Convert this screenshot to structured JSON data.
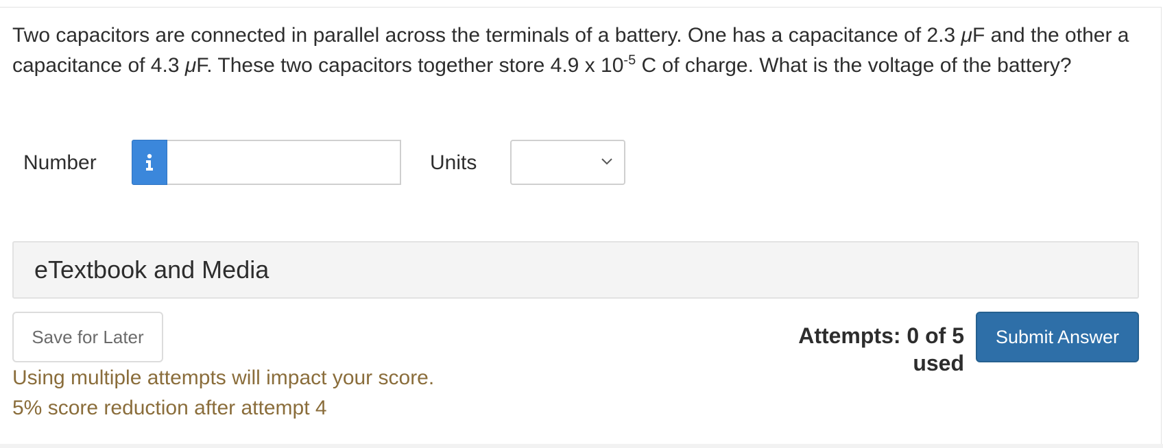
{
  "question": {
    "part1": "Two capacitors are connected in parallel across the terminals of a battery. One has a capacitance of 2.3 ",
    "mu1": "μ",
    "part2": "F and the other a capacitance of 4.3 ",
    "mu2": "μ",
    "part3": "F. These two capacitors together store 4.9 x 10",
    "exponent": "-5",
    "part4": " C of charge. What is the voltage of the battery?"
  },
  "answer_row": {
    "number_label": "Number",
    "info_icon": "info-icon",
    "number_value": "",
    "units_label": "Units",
    "units_selected": ""
  },
  "media": {
    "label": "eTextbook and Media"
  },
  "footer": {
    "save_label": "Save for Later",
    "attempts_text": "Attempts: 0 of 5 used",
    "submit_label": "Submit Answer",
    "warning_line1": "Using multiple attempts will impact your score.",
    "warning_line2": "5% score reduction after attempt 4"
  },
  "colors": {
    "info_button": "#3b87db",
    "submit_button": "#2e6fa8",
    "warning_text": "#8a6d3b",
    "media_bar": "#f4f4f4"
  }
}
